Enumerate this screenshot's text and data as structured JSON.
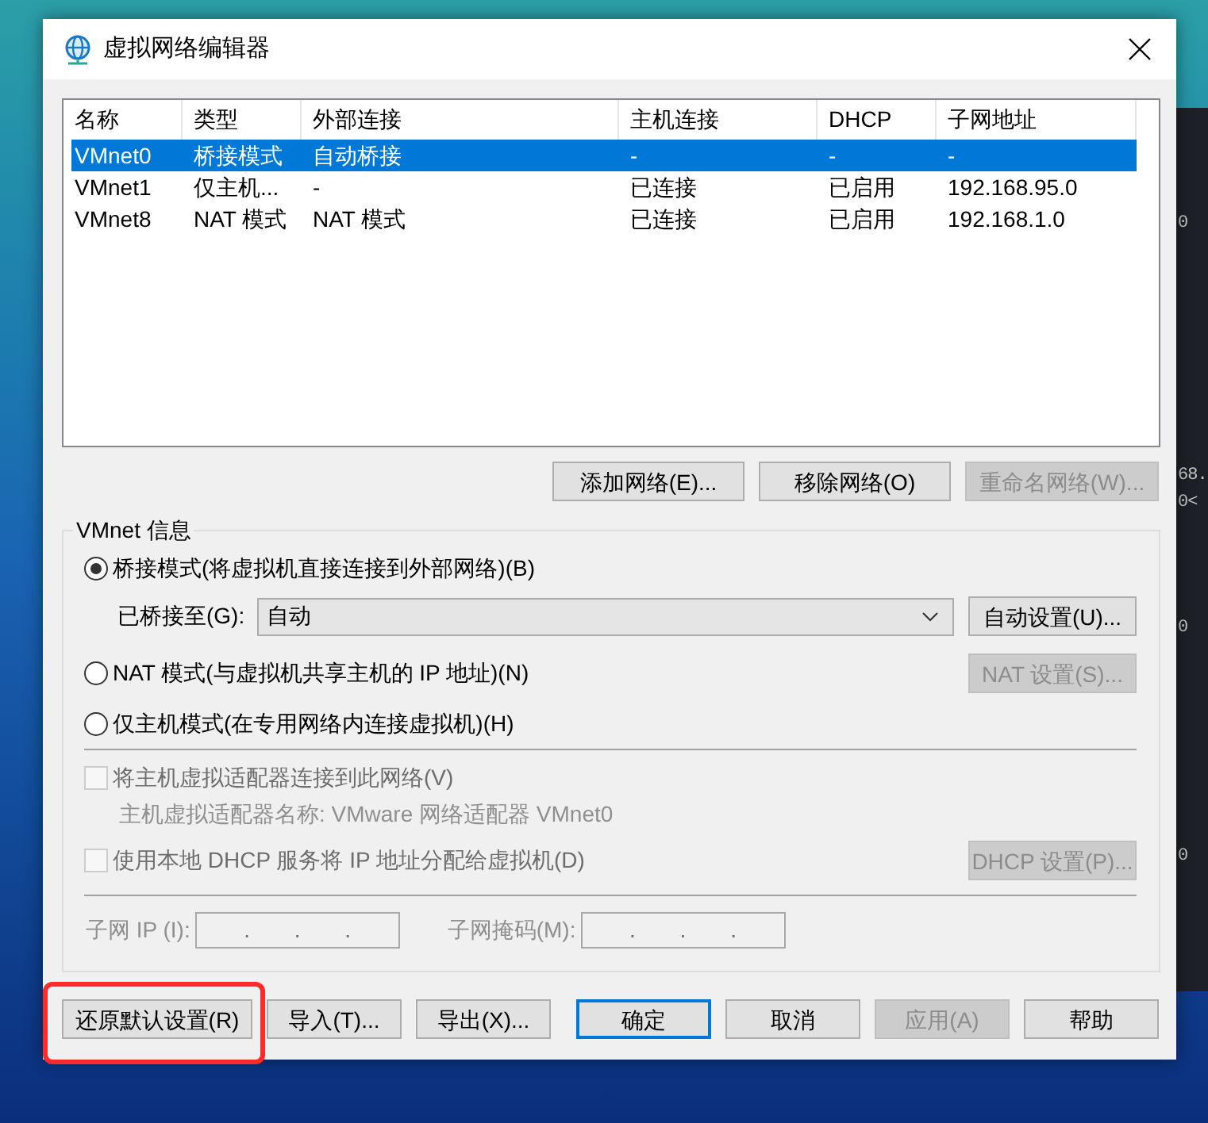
{
  "desktop": {
    "terminal_lines": [
      "0",
      "68.",
      "0<",
      "0",
      "0"
    ]
  },
  "window": {
    "title": "虚拟网络编辑器"
  },
  "network_table": {
    "columns": [
      "名称",
      "类型",
      "外部连接",
      "主机连接",
      "DHCP",
      "子网地址"
    ],
    "rows": [
      {
        "cells": [
          "VMnet0",
          "桥接模式",
          "自动桥接",
          "-",
          "-",
          "-"
        ],
        "selected": true
      },
      {
        "cells": [
          "VMnet1",
          "仅主机...",
          "-",
          "已连接",
          "已启用",
          "192.168.95.0"
        ],
        "selected": false
      },
      {
        "cells": [
          "VMnet8",
          "NAT 模式",
          "NAT 模式",
          "已连接",
          "已启用",
          "192.168.1.0"
        ],
        "selected": false
      }
    ]
  },
  "network_buttons": [
    {
      "label": "添加网络(E)...",
      "disabled": false
    },
    {
      "label": "移除网络(O)",
      "disabled": false
    },
    {
      "label": "重命名网络(W)...",
      "disabled": true
    }
  ],
  "vmnet_info": {
    "title": "VMnet 信息",
    "bridged_mode": {
      "label": "桥接模式(将虚拟机直接连接到外部网络)(B)",
      "selected": true
    },
    "bridged_to": {
      "label": "已桥接至(G):",
      "value": "自动",
      "disabled": false
    },
    "auto_settings_button": {
      "label": "自动设置(U)...",
      "disabled": false
    },
    "nat_mode": {
      "label": "NAT 模式(与虚拟机共享主机的 IP 地址)(N)",
      "selected": false
    },
    "nat_settings_button": {
      "label": "NAT 设置(S)...",
      "disabled": true
    },
    "host_only_mode": {
      "label": "仅主机模式(在专用网络内连接虚拟机)(H)",
      "selected": false
    },
    "connect_adapter": {
      "label": "将主机虚拟适配器连接到此网络(V)",
      "checked": false,
      "disabled": true
    },
    "adapter_name": "主机虚拟适配器名称: VMware 网络适配器 VMnet0",
    "use_dhcp": {
      "label": "使用本地 DHCP 服务将 IP 地址分配给虚拟机(D)",
      "checked": false,
      "disabled": true
    },
    "dhcp_settings_button": {
      "label": "DHCP 设置(P)...",
      "disabled": true
    },
    "subnet_ip": {
      "label": "子网 IP (I):",
      "value": ". . .",
      "disabled": true
    },
    "subnet_mask": {
      "label": "子网掩码(M):",
      "value": ". . .",
      "disabled": true
    }
  },
  "footer": {
    "left_buttons": [
      {
        "label": "还原默认设置(R)",
        "disabled": false,
        "highlighted": true
      },
      {
        "label": "导入(T)...",
        "disabled": false,
        "highlighted": false
      },
      {
        "label": "导出(X)...",
        "disabled": false,
        "highlighted": false
      }
    ],
    "right_buttons": [
      {
        "label": "确定",
        "disabled": false,
        "default": true
      },
      {
        "label": "取消",
        "disabled": false,
        "default": false
      },
      {
        "label": "应用(A)",
        "disabled": true,
        "default": false
      },
      {
        "label": "帮助",
        "disabled": false,
        "default": false
      }
    ]
  }
}
